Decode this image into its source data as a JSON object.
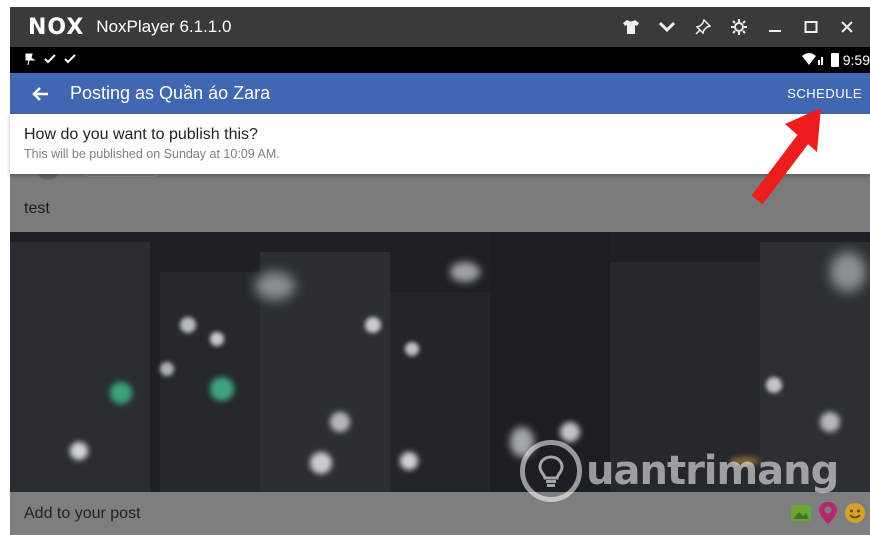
{
  "window": {
    "logo": "NOX",
    "title": "NoxPlayer 6.1.1.0",
    "controls": [
      "shirt-icon",
      "chevron-down-icon",
      "pin-icon",
      "gear-icon",
      "minimize-icon",
      "maximize-icon",
      "close-icon"
    ]
  },
  "status_bar": {
    "time": "9:59"
  },
  "app_bar": {
    "title": "Posting as Quần áo Zara",
    "schedule_label": "SCHEDULE",
    "background": "#4267b2"
  },
  "publish": {
    "question": "How do you want to publish this?",
    "subtitle": "This will be published on Sunday at 10:09 AM."
  },
  "post": {
    "text": "test"
  },
  "add_bar": {
    "label": "Add to your post",
    "icons": [
      "photo-icon",
      "location-pin-icon",
      "emoji-icon"
    ]
  },
  "watermark": {
    "text": "uantrimang"
  },
  "colors": {
    "accent_red": "#ee1c1c"
  }
}
